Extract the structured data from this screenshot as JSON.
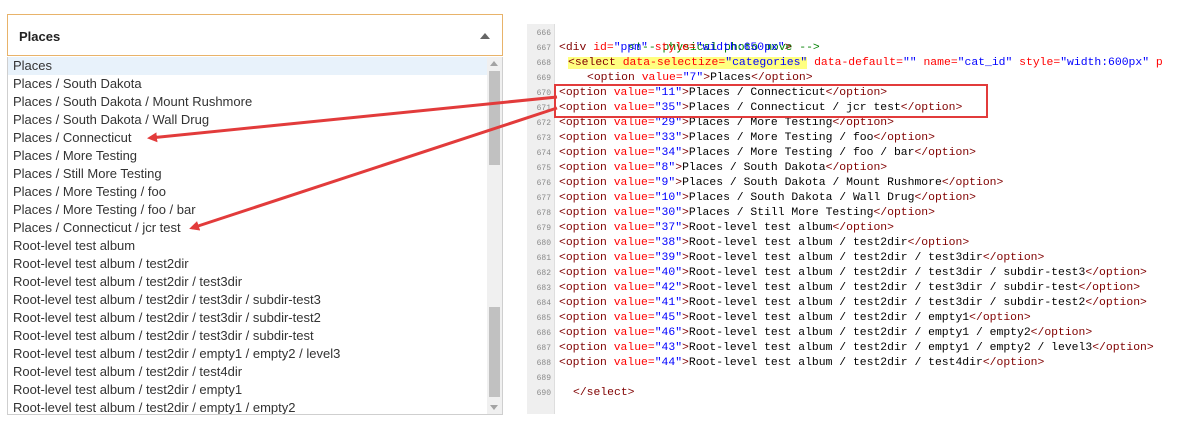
{
  "select": {
    "value": "Places"
  },
  "dropdown": {
    "options": [
      "Places",
      "Places / South Dakota",
      "Places / South Dakota / Mount Rushmore",
      "Places / South Dakota / Wall Drug",
      "Places / Connecticut",
      "Places / More Testing",
      "Places / Still More Testing",
      "Places / More Testing / foo",
      "Places / More Testing / foo / bar",
      "Places / Connecticut / jcr test",
      "Root-level test album",
      "Root-level test album / test2dir",
      "Root-level test album / test2dir / test3dir",
      "Root-level test album / test2dir / test3dir / subdir-test3",
      "Root-level test album / test2dir / test3dir / subdir-test2",
      "Root-level test album / test2dir / test3dir / subdir-test",
      "Root-level test album / test2dir / empty1 / empty2 / level3",
      "Root-level test album / test2dir / test4dir",
      "Root-level test album / test2dir / empty1",
      "Root-level test album / test2dir / empty1 / empty2"
    ]
  },
  "editor": {
    "line_numbers": [
      "666",
      "667",
      "668",
      "669",
      "670",
      "671",
      "672",
      "673",
      "674",
      "675",
      "676",
      "677",
      "678",
      "679",
      "680",
      "681",
      "682",
      "683",
      "684",
      "685",
      "686",
      "687",
      "688",
      "689",
      "690"
    ],
    "comment": "<!-- physical photo move -->",
    "div_line": {
      "open": "<div ",
      "id_attr": "id=",
      "id_val": "\"ppm\"",
      "style_attr": " style=",
      "style_val": "\"width:650px\"",
      "close": ">"
    },
    "select_line": {
      "open": "<select ",
      "attr1": "data-selectize=",
      "val1": "\"categories\"",
      "attr2": " data-default=",
      "val2": "\"\"",
      "attr3": " name=",
      "val3": "\"cat_id\"",
      "attr4": " style=",
      "val4": "\"width:600px\"",
      "tail": " p"
    },
    "option_open": "<option ",
    "option_attr": "value=",
    "option_close_tag": "</option>",
    "options": [
      {
        "value": "\"7\"",
        "text": "Places"
      },
      {
        "value": "\"11\"",
        "text": "Places / Connecticut"
      },
      {
        "value": "\"35\"",
        "text": "Places / Connecticut / jcr test"
      },
      {
        "value": "\"29\"",
        "text": "Places / More Testing"
      },
      {
        "value": "\"33\"",
        "text": "Places / More Testing / foo"
      },
      {
        "value": "\"34\"",
        "text": "Places / More Testing / foo / bar"
      },
      {
        "value": "\"8\"",
        "text": "Places / South Dakota"
      },
      {
        "value": "\"9\"",
        "text": "Places / South Dakota / Mount Rushmore"
      },
      {
        "value": "\"10\"",
        "text": "Places / South Dakota / Wall Drug"
      },
      {
        "value": "\"30\"",
        "text": "Places / Still More Testing"
      },
      {
        "value": "\"37\"",
        "text": "Root-level test album"
      },
      {
        "value": "\"38\"",
        "text": "Root-level test album / test2dir"
      },
      {
        "value": "\"39\"",
        "text": "Root-level test album / test2dir / test3dir"
      },
      {
        "value": "\"40\"",
        "text": "Root-level test album / test2dir / test3dir / subdir-test3"
      },
      {
        "value": "\"42\"",
        "text": "Root-level test album / test2dir / test3dir / subdir-test"
      },
      {
        "value": "\"41\"",
        "text": "Root-level test album / test2dir / test3dir / subdir-test2"
      },
      {
        "value": "\"45\"",
        "text": "Root-level test album / test2dir / empty1"
      },
      {
        "value": "\"46\"",
        "text": "Root-level test album / test2dir / empty1 / empty2"
      },
      {
        "value": "\"43\"",
        "text": "Root-level test album / test2dir / empty1 / empty2 / level3"
      },
      {
        "value": "\"44\"",
        "text": "Root-level test album / test2dir / test4dir"
      }
    ],
    "select_close": "</select>"
  },
  "colors": {
    "annotation_red": "#e23b3b",
    "select_border": "#e8b36a",
    "highlight_yellow": "#ffff80"
  }
}
